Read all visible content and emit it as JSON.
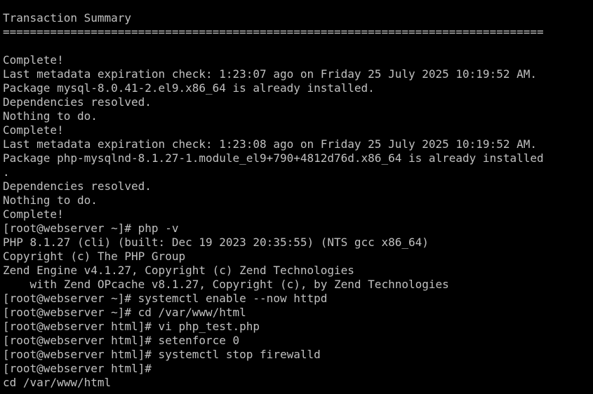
{
  "terminal": {
    "colors": {
      "background": "#000000",
      "foreground": "#c0c0c0"
    },
    "lines": [
      "Transaction Summary",
      "================================================================================",
      "",
      "Complete!",
      "Last metadata expiration check: 1:23:07 ago on Friday 25 July 2025 10:19:52 AM.",
      "Package mysql-8.0.41-2.el9.x86_64 is already installed.",
      "Dependencies resolved.",
      "Nothing to do.",
      "Complete!",
      "Last metadata expiration check: 1:23:08 ago on Friday 25 July 2025 10:19:52 AM.",
      "Package php-mysqlnd-8.1.27-1.module_el9+790+4812d76d.x86_64 is already installed",
      ".",
      "Dependencies resolved.",
      "Nothing to do.",
      "Complete!",
      "[root@webserver ~]# php -v",
      "PHP 8.1.27 (cli) (built: Dec 19 2023 20:35:55) (NTS gcc x86_64)",
      "Copyright (c) The PHP Group",
      "Zend Engine v4.1.27, Copyright (c) Zend Technologies",
      "    with Zend OPcache v8.1.27, Copyright (c), by Zend Technologies",
      "[root@webserver ~]# systemctl enable --now httpd",
      "[root@webserver ~]# cd /var/www/html",
      "[root@webserver html]# vi php_test.php",
      "[root@webserver html]# setenforce 0",
      "[root@webserver html]# systemctl stop firewalld",
      "[root@webserver html]#",
      "cd /var/www/html"
    ]
  }
}
